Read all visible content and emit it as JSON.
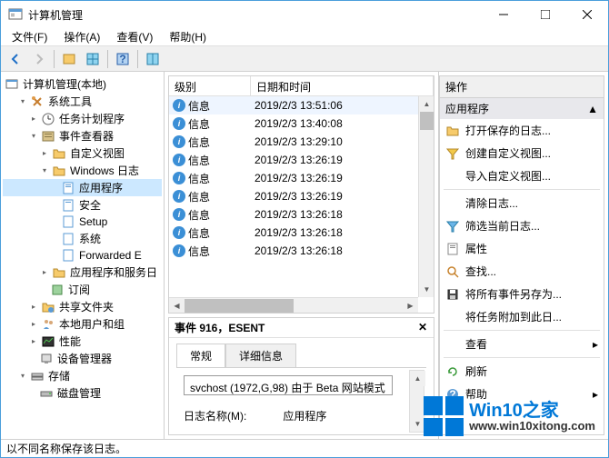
{
  "window": {
    "title": "计算机管理"
  },
  "menubar": [
    "文件(F)",
    "操作(A)",
    "查看(V)",
    "帮助(H)"
  ],
  "tree": {
    "root": "计算机管理(本地)",
    "sys_tools": "系统工具",
    "task_sched": "任务计划程序",
    "event_viewer": "事件查看器",
    "custom_views": "自定义视图",
    "windows_logs": "Windows 日志",
    "application": "应用程序",
    "security": "安全",
    "setup": "Setup",
    "system": "系统",
    "forwarded": "Forwarded E",
    "app_service": "应用程序和服务日",
    "subscriptions": "订阅",
    "shared_folders": "共享文件夹",
    "local_users": "本地用户和组",
    "performance": "性能",
    "device_mgr": "设备管理器",
    "storage": "存储",
    "disk_mgmt": "磁盘管理"
  },
  "list": {
    "headers": {
      "level": "级别",
      "datetime": "日期和时间"
    },
    "rows": [
      {
        "level": "信息",
        "datetime": "2019/2/3 13:51:06"
      },
      {
        "level": "信息",
        "datetime": "2019/2/3 13:40:08"
      },
      {
        "level": "信息",
        "datetime": "2019/2/3 13:29:10"
      },
      {
        "level": "信息",
        "datetime": "2019/2/3 13:26:19"
      },
      {
        "level": "信息",
        "datetime": "2019/2/3 13:26:19"
      },
      {
        "level": "信息",
        "datetime": "2019/2/3 13:26:19"
      },
      {
        "level": "信息",
        "datetime": "2019/2/3 13:26:18"
      },
      {
        "level": "信息",
        "datetime": "2019/2/3 13:26:18"
      },
      {
        "level": "信息",
        "datetime": "2019/2/3 13:26:18"
      }
    ]
  },
  "detail": {
    "header": "事件 916，ESENT",
    "tabs": {
      "general": "常规",
      "details": "详细信息"
    },
    "text": "svchost (1972,G,98) 由于 Beta 网站模式",
    "log_name_label": "日志名称(M):",
    "log_name_value": "应用程序"
  },
  "actions": {
    "title": "操作",
    "group": "应用程序",
    "items": {
      "open_saved": "打开保存的日志...",
      "create_custom": "创建自定义视图...",
      "import_custom": "导入自定义视图...",
      "clear_log": "清除日志...",
      "filter_current": "筛选当前日志...",
      "properties": "属性",
      "find": "查找...",
      "save_all": "将所有事件另存为...",
      "attach_task": "将任务附加到此日...",
      "view": "查看",
      "refresh": "刷新",
      "help": "帮助"
    }
  },
  "statusbar": "以不同名称保存该日志。",
  "watermark": {
    "brand": "Win10",
    "site": "www.win10xitong.com",
    "suffix": "之家"
  }
}
